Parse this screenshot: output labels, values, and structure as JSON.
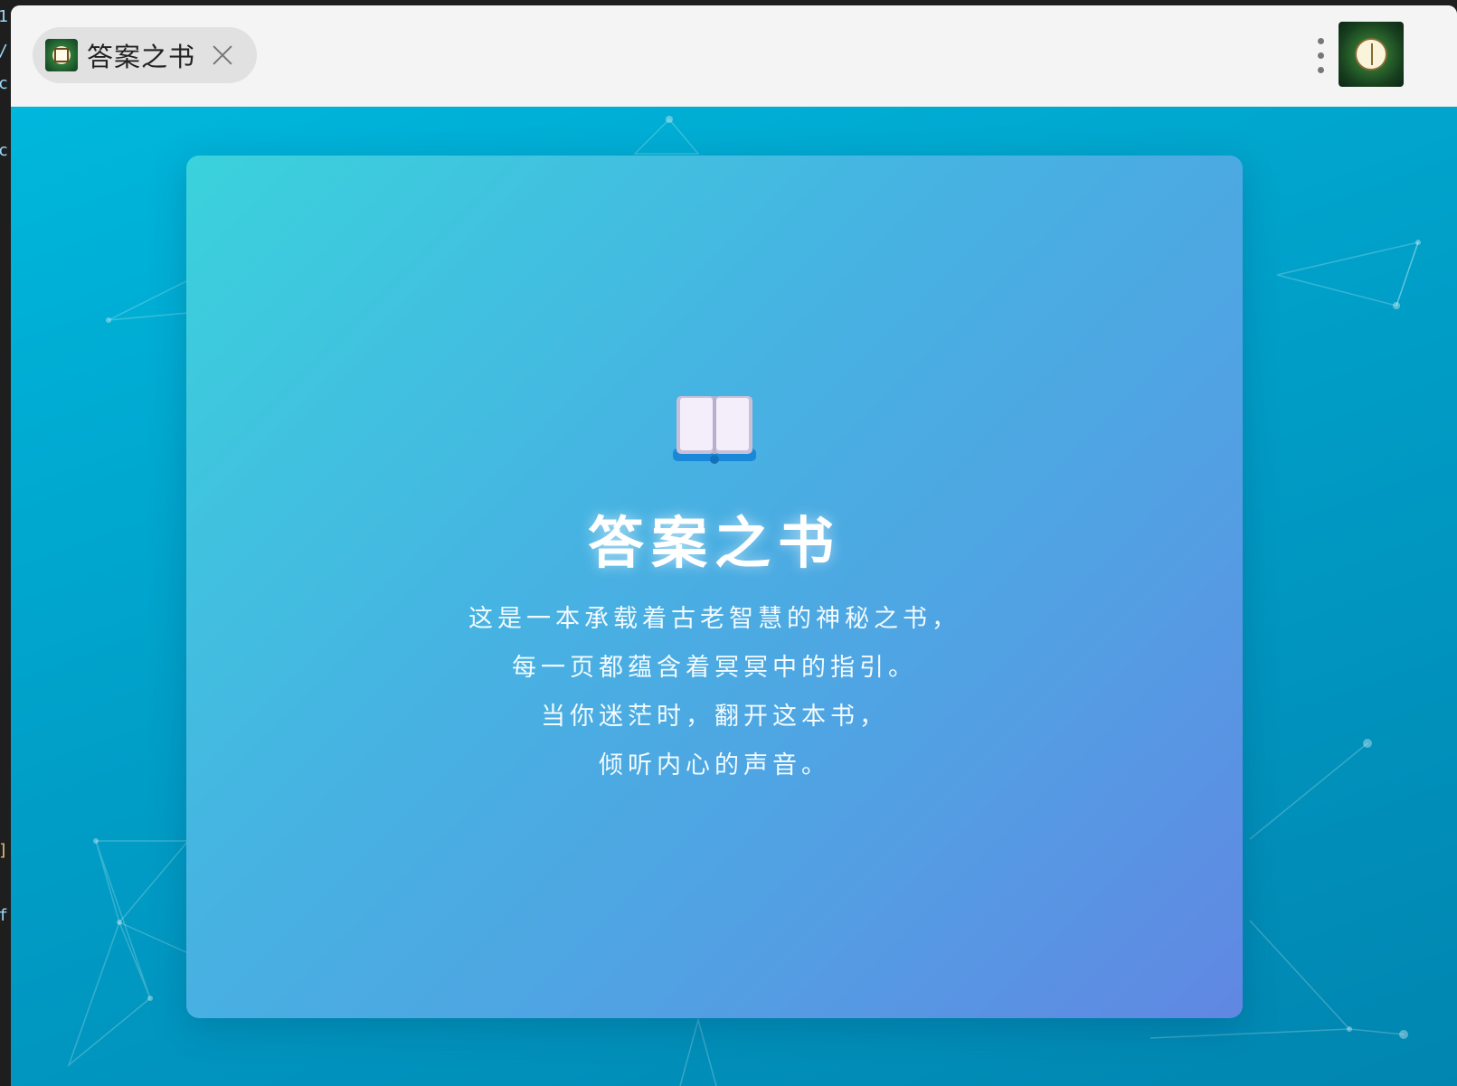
{
  "tab": {
    "title": "答案之书"
  },
  "titlebar": {
    "menu_icon": "kebab-menu-icon",
    "app_icon": "book-of-answers-app-icon"
  },
  "card": {
    "icon": "open-book-icon",
    "title": "答案之书",
    "lines": [
      "这是一本承载着古老智慧的神秘之书，",
      "每一页都蕴含着冥冥中的指引。",
      "当你迷茫时，翻开这本书，",
      "倾听内心的声音。"
    ]
  },
  "colors": {
    "background": "#00a8d0",
    "card_start": "#3ad2dc",
    "card_end": "#6087e3",
    "text": "#ffffff"
  }
}
